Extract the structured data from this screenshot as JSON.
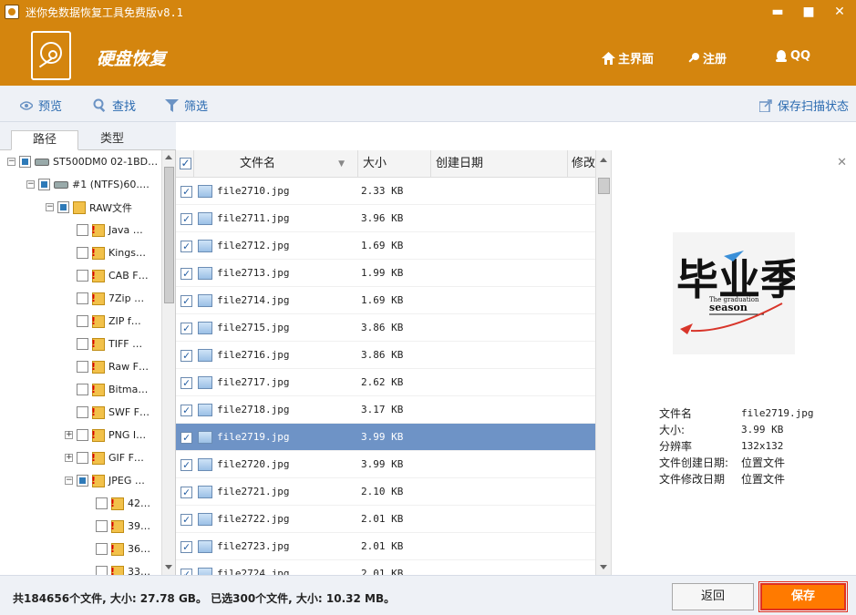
{
  "window": {
    "title": "迷你免数据恢复工具免费版v8.1",
    "minimize": "▬",
    "maximize": "■",
    "close": "✕"
  },
  "header": {
    "app_name": "硬盘恢复",
    "nav": [
      "主界面",
      "注册",
      "QQ"
    ]
  },
  "toolbar": {
    "preview": "预览",
    "search": "查找",
    "filter": "筛选",
    "save_scan": "保存扫描状态"
  },
  "left_tabs": [
    "路径",
    "类型"
  ],
  "tree": [
    {
      "exp": "-",
      "text": "ST500DM0 02-1BD…",
      "icon": "hdd-icon",
      "state": "partial",
      "indent": 0
    },
    {
      "exp": "-",
      "text": "#1 (NTFS)60.…",
      "icon": "hdd-icon",
      "state": "partial",
      "indent": 1
    },
    {
      "exp": "-",
      "text": "RAW文件",
      "icon": "folder-icon",
      "state": "partial",
      "indent": 2
    },
    {
      "exp": "",
      "text": "Java …",
      "icon": "folder-warn-icon",
      "state": "unchecked",
      "indent": 3
    },
    {
      "exp": "",
      "text": "Kings…",
      "icon": "folder-warn-icon",
      "state": "unchecked",
      "indent": 3
    },
    {
      "exp": "",
      "text": "CAB F…",
      "icon": "folder-warn-icon",
      "state": "unchecked",
      "indent": 3
    },
    {
      "exp": "",
      "text": "7Zip …",
      "icon": "folder-warn-icon",
      "state": "unchecked",
      "indent": 3
    },
    {
      "exp": "",
      "text": "ZIP f…",
      "icon": "folder-warn-icon",
      "state": "unchecked",
      "indent": 3
    },
    {
      "exp": "",
      "text": "TIFF …",
      "icon": "folder-warn-icon",
      "state": "unchecked",
      "indent": 3
    },
    {
      "exp": "",
      "text": "Raw F…",
      "icon": "folder-warn-icon",
      "state": "unchecked",
      "indent": 3
    },
    {
      "exp": "",
      "text": "Bitma…",
      "icon": "folder-warn-icon",
      "state": "unchecked",
      "indent": 3
    },
    {
      "exp": "",
      "text": "SWF F…",
      "icon": "folder-warn-icon",
      "state": "unchecked",
      "indent": 3
    },
    {
      "exp": "+",
      "text": "PNG I…",
      "icon": "folder-warn-icon",
      "state": "unchecked",
      "indent": 3
    },
    {
      "exp": "+",
      "text": "GIF F…",
      "icon": "folder-warn-icon",
      "state": "unchecked",
      "indent": 3
    },
    {
      "exp": "-",
      "text": "JPEG …",
      "icon": "folder-warn-icon",
      "state": "partial",
      "indent": 3
    },
    {
      "exp": "",
      "text": "42…",
      "icon": "folder-warn-icon",
      "state": "unchecked",
      "indent": 4
    },
    {
      "exp": "",
      "text": "39…",
      "icon": "folder-warn-icon",
      "state": "unchecked",
      "indent": 4
    },
    {
      "exp": "",
      "text": "36…",
      "icon": "folder-warn-icon",
      "state": "unchecked",
      "indent": 4
    },
    {
      "exp": "",
      "text": "33…",
      "icon": "folder-warn-icon",
      "state": "unchecked",
      "indent": 4
    }
  ],
  "grid": {
    "headers": {
      "name": "文件名",
      "size": "大小",
      "created": "创建日期",
      "modified": "修改"
    },
    "rows": [
      {
        "name": "file2710.jpg",
        "size": "2.33 KB"
      },
      {
        "name": "file2711.jpg",
        "size": "3.96 KB"
      },
      {
        "name": "file2712.jpg",
        "size": "1.69 KB"
      },
      {
        "name": "file2713.jpg",
        "size": "1.99 KB"
      },
      {
        "name": "file2714.jpg",
        "size": "1.69 KB"
      },
      {
        "name": "file2715.jpg",
        "size": "3.86 KB"
      },
      {
        "name": "file2716.jpg",
        "size": "3.86 KB"
      },
      {
        "name": "file2717.jpg",
        "size": "2.62 KB"
      },
      {
        "name": "file2718.jpg",
        "size": "3.17 KB"
      },
      {
        "name": "file2719.jpg",
        "size": "3.99 KB",
        "selected": true
      },
      {
        "name": "file2720.jpg",
        "size": "3.99 KB"
      },
      {
        "name": "file2721.jpg",
        "size": "2.10 KB"
      },
      {
        "name": "file2722.jpg",
        "size": "2.01 KB"
      },
      {
        "name": "file2723.jpg",
        "size": "2.01 KB"
      },
      {
        "name": "file2724.jpg",
        "size": "2.01 KB"
      }
    ]
  },
  "preview": {
    "logo_text": "毕业季",
    "logo_sub1": "The graduation",
    "logo_sub2": "season",
    "labels": [
      "文件名",
      "大小:",
      "分辨率",
      "文件创建日期:",
      "文件修改日期"
    ],
    "values": [
      "file2719.jpg",
      "3.99 KB",
      "132x132",
      "位置文件",
      "位置文件"
    ]
  },
  "status": {
    "text": "共184656个文件, 大小: 27.78 GB。 已选300个文件, 大小: 10.32 MB。",
    "back": "返回",
    "save": "保存"
  },
  "colors": {
    "brand": "#d4850e",
    "accent": "#ff7a00",
    "selection": "#6e93c6"
  }
}
